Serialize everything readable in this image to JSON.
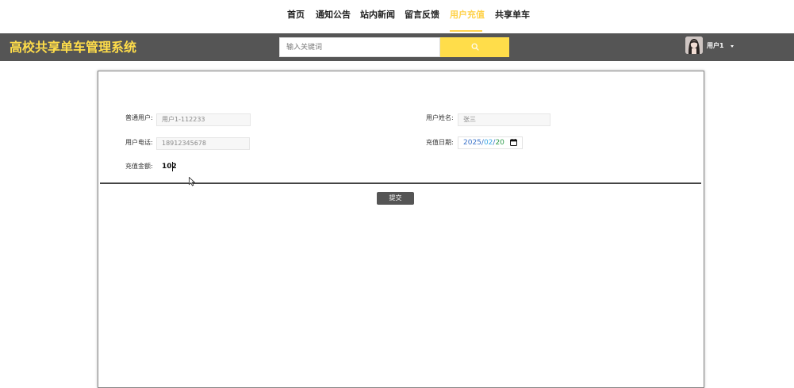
{
  "nav": {
    "items": [
      {
        "label": "首页"
      },
      {
        "label": "通知公告"
      },
      {
        "label": "站内新闻"
      },
      {
        "label": "留言反馈"
      },
      {
        "label": "用户充值",
        "active": true
      },
      {
        "label": "共享单车"
      }
    ]
  },
  "header": {
    "title": "高校共享单车管理系统",
    "search_placeholder": "输入关键词",
    "user_name": "用户1"
  },
  "form": {
    "user_account_label": "普通用户:",
    "user_account_value": "用户1-112233",
    "user_name_label": "用户姓名:",
    "user_name_value": "张三",
    "phone_label": "用户电话:",
    "phone_value": "18912345678",
    "date_label": "充值日期:",
    "date_year": "2025",
    "date_month": "02",
    "date_day": "20",
    "date_separator": "/",
    "amount_label": "充值金额:",
    "amount_value": "102",
    "submit_label": "提交"
  },
  "colors": {
    "accent": "#ffdd4a",
    "header_bg": "#555555",
    "button_bg": "#555555"
  }
}
